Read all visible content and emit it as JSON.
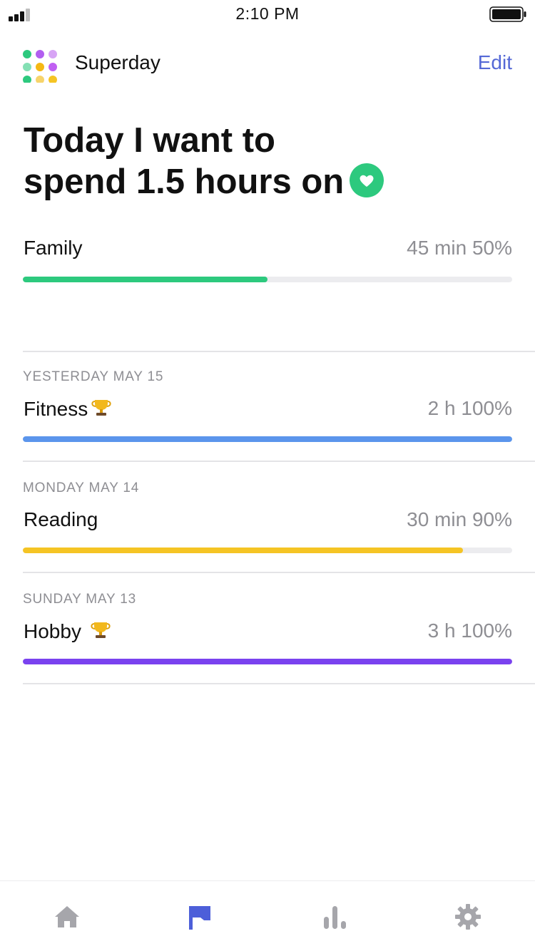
{
  "status_bar": {
    "time": "2:10 PM",
    "signal_icon": "signal-bars-icon",
    "battery_icon": "battery-full-icon"
  },
  "header": {
    "logo_icon": "dots-grid-logo",
    "app_name": "Superday",
    "edit_label": "Edit"
  },
  "headline": {
    "line1": "Today I want to",
    "line2": "spend 1.5 hours on",
    "badge_icon": "heart-icon"
  },
  "today_goal": {
    "name": "Family",
    "duration": "45 min",
    "percent": "50%",
    "progress": 0.5,
    "color": "#2dc97e"
  },
  "history": [
    {
      "date": "YESTERDAY MAY 15",
      "name": "Fitness",
      "trophy": "trophy-icon",
      "duration": "2 h",
      "percent": "100%",
      "progress": 1.0,
      "color": "#5b95ec"
    },
    {
      "date": "MONDAY MAY 14",
      "name": "Reading",
      "duration": "30 min",
      "percent": "90%",
      "progress": 0.9,
      "color": "#f5c424"
    },
    {
      "date": "SUNDAY MAY 13",
      "name": "Hobby",
      "trophy": "trophy-icon",
      "duration": "3 h",
      "percent": "100%",
      "progress": 1.0,
      "color": "#7a42ef"
    }
  ],
  "tabbar": {
    "tabs": [
      {
        "icon": "home-icon",
        "active": false
      },
      {
        "icon": "flag-icon",
        "active": true
      },
      {
        "icon": "bar-chart-icon",
        "active": false
      },
      {
        "icon": "gear-icon",
        "active": false
      }
    ],
    "active_color": "#4d5fd9",
    "inactive_color": "#a6a6ab"
  }
}
